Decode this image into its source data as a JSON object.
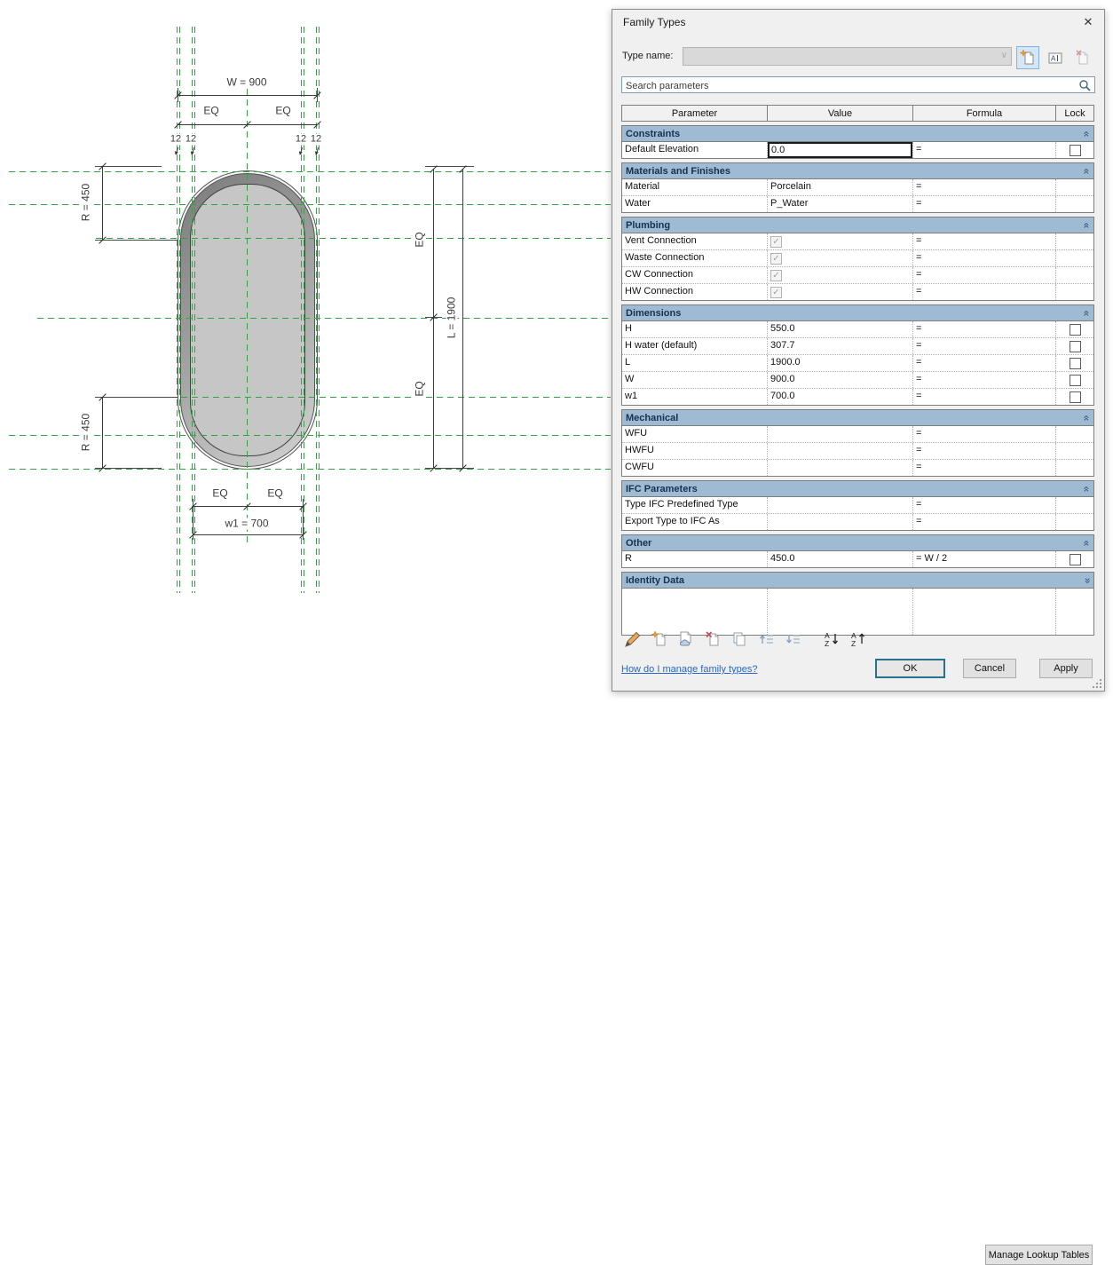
{
  "drawing": {
    "labels": {
      "w": "W = 900",
      "eq": "EQ",
      "gap": "12",
      "w1": "w1 = 700",
      "r_top": "R = 450",
      "r_bottom": "R = 450",
      "l": "L = 1900"
    },
    "colors": {
      "reference_plane_green": "#35a046",
      "dimension": "#3b3b3b",
      "tub_rim_dark": "#7b7b7b",
      "tub_rim_light": "#d3d3d3",
      "tub_fill": "#c6c6c6"
    }
  },
  "dialog": {
    "title": "Family Types",
    "close_glyph": "✕",
    "type_name": {
      "label": "Type name:",
      "value": ""
    },
    "search": {
      "placeholder": "Search parameters"
    },
    "table": {
      "columns": [
        "Parameter",
        "Value",
        "Formula",
        "Lock"
      ],
      "sections": [
        {
          "name": "Constraints",
          "collapsed": false,
          "rows": [
            {
              "param": "Default Elevation",
              "value": "0.0",
              "kind": "editbox",
              "formula": "=",
              "lock": true
            }
          ]
        },
        {
          "name": "Materials and Finishes",
          "collapsed": false,
          "rows": [
            {
              "param": "Material",
              "value": "Porcelain",
              "kind": "text",
              "formula": "=",
              "lock": false
            },
            {
              "param": "Water",
              "value": "P_Water",
              "kind": "text",
              "formula": "=",
              "lock": false
            }
          ]
        },
        {
          "name": "Plumbing",
          "collapsed": false,
          "rows": [
            {
              "param": "Vent Connection",
              "value": "",
              "kind": "checkbox",
              "formula": "=",
              "lock": false
            },
            {
              "param": "Waste Connection",
              "value": "",
              "kind": "checkbox",
              "formula": "=",
              "lock": false
            },
            {
              "param": "CW Connection",
              "value": "",
              "kind": "checkbox",
              "formula": "=",
              "lock": false
            },
            {
              "param": "HW Connection",
              "value": "",
              "kind": "checkbox",
              "formula": "=",
              "lock": false
            }
          ]
        },
        {
          "name": "Dimensions",
          "collapsed": false,
          "rows": [
            {
              "param": "H",
              "value": "550.0",
              "kind": "text",
              "formula": "=",
              "lock": true
            },
            {
              "param": "H water (default)",
              "value": "307.7",
              "kind": "text",
              "formula": "=",
              "lock": true
            },
            {
              "param": "L",
              "value": "1900.0",
              "kind": "text",
              "formula": "=",
              "lock": true
            },
            {
              "param": "W",
              "value": "900.0",
              "kind": "text",
              "formula": "=",
              "lock": true
            },
            {
              "param": "w1",
              "value": "700.0",
              "kind": "text",
              "formula": "=",
              "lock": true
            }
          ]
        },
        {
          "name": "Mechanical",
          "collapsed": false,
          "rows": [
            {
              "param": "WFU",
              "value": "",
              "kind": "none",
              "formula": "=",
              "lock": false
            },
            {
              "param": "HWFU",
              "value": "",
              "kind": "none",
              "formula": "=",
              "lock": false
            },
            {
              "param": "CWFU",
              "value": "",
              "kind": "none",
              "formula": "=",
              "lock": false
            }
          ]
        },
        {
          "name": "IFC Parameters",
          "collapsed": false,
          "rows": [
            {
              "param": "Type IFC Predefined Type",
              "value": "",
              "kind": "none",
              "formula": "=",
              "lock": false
            },
            {
              "param": "Export Type to IFC As",
              "value": "",
              "kind": "none",
              "formula": "=",
              "lock": false
            }
          ]
        },
        {
          "name": "Other",
          "collapsed": false,
          "rows": [
            {
              "param": "R",
              "value": "450.0",
              "kind": "text",
              "formula": "= W / 2",
              "lock": true
            }
          ]
        },
        {
          "name": "Identity Data",
          "collapsed": true,
          "rows": []
        }
      ]
    },
    "toolbar": {
      "icons": [
        "edit-parameter",
        "new-parameter",
        "shared-parameter",
        "delete-parameter",
        "duplicate-parameter",
        "move-up",
        "move-down",
        "sort-ascending",
        "sort-descending"
      ],
      "manage_lookup_label": "Manage Lookup Tables"
    },
    "footer": {
      "help_link": "How do I manage family types?",
      "ok": "OK",
      "cancel": "Cancel",
      "apply": "Apply"
    }
  }
}
